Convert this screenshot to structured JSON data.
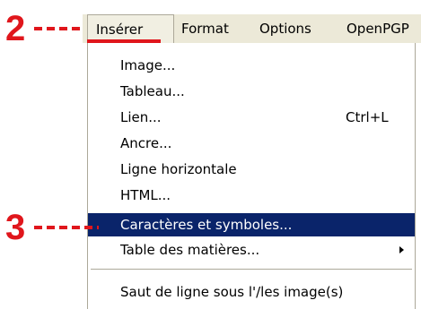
{
  "markers": {
    "step_2": "2",
    "step_3": "3",
    "color": "#e0161c"
  },
  "menubar": {
    "items": [
      {
        "label": "Insérer",
        "active": true
      },
      {
        "label": "Format"
      },
      {
        "label": "Options"
      },
      {
        "label": "OpenPGP"
      }
    ]
  },
  "menu": {
    "items": [
      {
        "label": "Image..."
      },
      {
        "label": "Tableau..."
      },
      {
        "label": "Lien...",
        "shortcut": "Ctrl+L"
      },
      {
        "label": "Ancre..."
      },
      {
        "label": "Ligne horizontale"
      },
      {
        "label": "HTML..."
      },
      {
        "label": "Caractères et symboles...",
        "highlighted": true
      },
      {
        "label": "Table des matières...",
        "submenu": true,
        "submenu_icon": "submenu-arrow-icon"
      },
      {
        "label": "Saut de ligne sous l'/les image(s)"
      }
    ],
    "highlight_color": "#0a246a"
  }
}
